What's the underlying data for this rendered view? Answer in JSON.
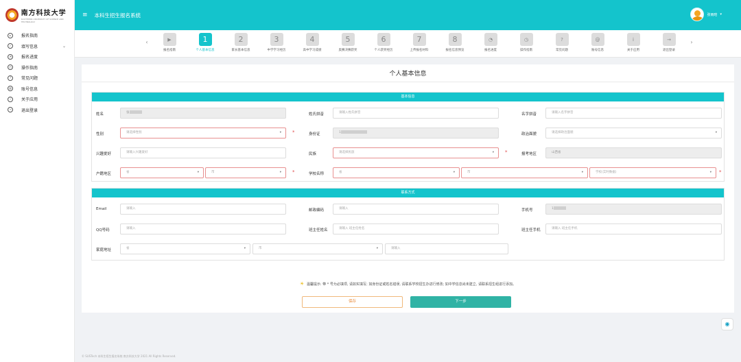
{
  "logo": {
    "name_cn": "南方科技大学",
    "name_en": "SOUTHERN UNIVERSITY OF SCIENCE AND TECHNOLOGY"
  },
  "header": {
    "app_title": "本科生招生报名系统",
    "user_name": "张雨晗",
    "caret": "▾",
    "menu_icon": "≡"
  },
  "sidebar": {
    "items": [
      {
        "label": "报名指南",
        "icon": "play-circle-icon",
        "glyph": "▸"
      },
      {
        "label": "填写信息",
        "icon": "check-circle-icon",
        "glyph": "✓",
        "chevron": "⌄"
      },
      {
        "label": "报名进度",
        "icon": "gauge-icon",
        "glyph": "◔"
      },
      {
        "label": "操作指南",
        "icon": "compass-icon",
        "glyph": "◷"
      },
      {
        "label": "常见问题",
        "icon": "question-icon",
        "glyph": "?"
      },
      {
        "label": "账号信息",
        "icon": "at-icon",
        "glyph": "@"
      },
      {
        "label": "关于应用",
        "icon": "info-icon",
        "glyph": "i"
      },
      {
        "label": "退出登录",
        "icon": "logout-icon",
        "glyph": "→"
      }
    ]
  },
  "steps": {
    "prev": "‹",
    "next": "›",
    "items": [
      {
        "label": "报名指南",
        "text": "▶",
        "icon": "play-icon",
        "active": false
      },
      {
        "label": "个人基本信息",
        "text": "1",
        "active": true
      },
      {
        "label": "家长基本信息",
        "text": "2",
        "active": false
      },
      {
        "label": "中学学习经历",
        "text": "3",
        "active": false
      },
      {
        "label": "高中学习成绩",
        "text": "4",
        "active": false
      },
      {
        "label": "奥赛决赛获奖",
        "text": "5",
        "active": false
      },
      {
        "label": "个人获奖经历",
        "text": "6",
        "active": false
      },
      {
        "label": "上传报名材料",
        "text": "7",
        "active": false
      },
      {
        "label": "报名信息预览",
        "text": "8",
        "active": false
      },
      {
        "label": "报名进度",
        "text": "◔",
        "icon": "gauge-icon",
        "active": false
      },
      {
        "label": "操作指南",
        "text": "◷",
        "icon": "compass-icon",
        "active": false
      },
      {
        "label": "常见问题",
        "text": "?",
        "icon": "question-icon",
        "active": false
      },
      {
        "label": "账号信息",
        "text": "@",
        "icon": "at-icon",
        "active": false
      },
      {
        "label": "关于应用",
        "text": "i",
        "icon": "info-icon",
        "active": false
      },
      {
        "label": "退出登录",
        "text": "→",
        "icon": "logout-icon",
        "active": false
      }
    ]
  },
  "form": {
    "title": "个人基本信息",
    "basic": {
      "heading": "基本信息",
      "name_label": "姓名",
      "name_value": "张",
      "pinyin_label": "姓氏拼音",
      "pinyin_ph": "请输入姓氏拼音",
      "given_label": "名字拼音",
      "given_ph": "请输入名字拼音",
      "gender_label": "性别",
      "gender_ph": "请选择性别",
      "id_label": "身份证",
      "id_value": "1",
      "political_label": "政治面貌",
      "political_ph": "请选择政治面貌",
      "hobby_label": "兴趣爱好",
      "hobby_ph": "请输入兴趣爱好",
      "ethnic_label": "民族",
      "ethnic_ph": "请选择民族",
      "region_label": "报考地区",
      "region_value": "山西省",
      "huji_label": "户籍地区",
      "huji_prov": "省",
      "huji_city": "市",
      "school_label": "学校名称",
      "school_prov": "省",
      "school_city": "市",
      "school_ph": "学校(实时数据)"
    },
    "contact": {
      "heading": "联系方式",
      "email_label": "Email",
      "email_ph": "请输入",
      "zip_label": "邮政编码",
      "zip_ph": "请输入",
      "phone_label": "手机号",
      "phone_value": "1",
      "qq_label": "QQ号码",
      "qq_ph": "请输入",
      "teacher_label": "班主任姓名",
      "teacher_ph": "请输入 班主任姓名",
      "teacher_phone_label": "班主任手机",
      "teacher_phone_ph": "请输入 班主任手机",
      "addr_label": "家庭地址",
      "addr_prov": "省",
      "addr_city": "市",
      "addr_ph": "请输入"
    },
    "star": "*",
    "tip": "温馨提示: 带 * 号为必填项, 请如实填写; 如身份证或姓名错误, 请联系学校招生办进行修改; 如中学信息尚未建立, 请联系招生组进行添加。",
    "tip_icon": "☀",
    "save_label": "保存",
    "next_label": "下一步"
  },
  "float_icon": "◉",
  "footer": "© SUSTech 本科生招生报名系统 南方科技大学 2021 All Rights Reserved.",
  "colors": {
    "accent": "#14c4cc",
    "next_button": "#30b3a5",
    "save_border": "#f0b87a",
    "required": "#e04848"
  }
}
